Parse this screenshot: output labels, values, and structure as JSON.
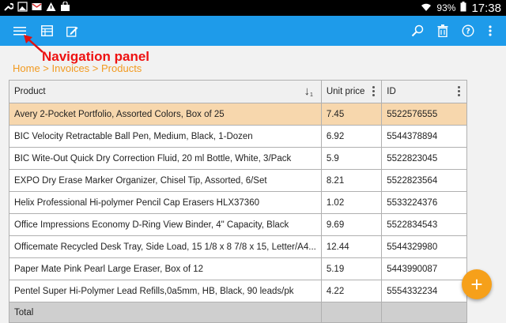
{
  "status_bar": {
    "battery": "93%",
    "time": "17:38"
  },
  "toolbar": {
    "left_icons": [
      "menu-icon",
      "table-icon",
      "edit-icon"
    ],
    "right_icons": [
      "search-icon",
      "trash-icon",
      "help-icon",
      "more-icon"
    ]
  },
  "annotation": {
    "label": "Navigation panel",
    "color": "#e11111"
  },
  "breadcrumb": {
    "text": "Home > Invoices > Products"
  },
  "table": {
    "columns": [
      {
        "label": "Product",
        "sort": "↓",
        "sort_index": "1"
      },
      {
        "label": "Unit price"
      },
      {
        "label": "ID"
      }
    ],
    "rows": [
      [
        "Avery 2-Pocket Portfolio, Assorted Colors, Box of 25",
        "7.45",
        "5522576555"
      ],
      [
        "BIC Velocity Retractable Ball Pen, Medium, Black, 1-Dozen",
        "6.92",
        "5544378894"
      ],
      [
        "BIC Wite-Out Quick Dry Correction Fluid, 20 ml Bottle, White, 3/Pack",
        "5.9",
        "5522823045"
      ],
      [
        "EXPO Dry Erase Marker Organizer, Chisel Tip, Assorted, 6/Set",
        "8.21",
        "5522823564"
      ],
      [
        "Helix Professional Hi-polymer Pencil Cap Erasers HLX37360",
        "1.02",
        "5533224376"
      ],
      [
        "Office Impressions Economy D-Ring View Binder, 4\" Capacity, Black",
        "9.69",
        "5522834543"
      ],
      [
        "Officemate Recycled Desk Tray, Side Load, 15 1/8 x 8 7/8 x 15, Letter/A4...",
        "12.44",
        "5544329980"
      ],
      [
        "Paper Mate Pink Pearl Large Eraser, Box of 12",
        "5.19",
        "5443990087"
      ],
      [
        "Pentel Super Hi-Polymer Lead Refills,0a5mm, HB, Black, 90 leads/pk",
        "4.22",
        "5554332234"
      ]
    ],
    "selected_row": 0,
    "total_label": "Total"
  },
  "fab": {
    "label": "+"
  },
  "colors": {
    "appbar": "#1e9bea",
    "accent": "#f29a1f",
    "selected_row": "#f7d7ad"
  }
}
